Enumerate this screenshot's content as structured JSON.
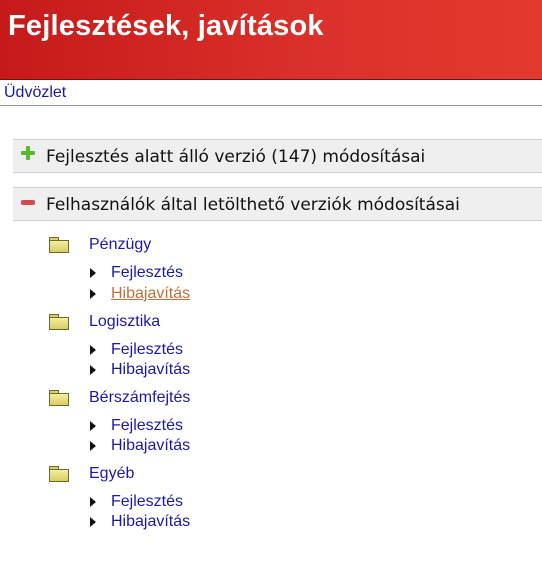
{
  "header": {
    "title": "Fejlesztések, javítások"
  },
  "breadcrumb": {
    "label": "Üdvözlet"
  },
  "sections": [
    {
      "label": "Fejlesztés alatt álló verzió (147) módosításai",
      "state": "collapsed",
      "icon": "plus-icon"
    },
    {
      "label": "Felhasználók által letölthető verziók módosításai",
      "state": "expanded",
      "icon": "minus-icon"
    }
  ],
  "categories": [
    {
      "label": "Pénzügy",
      "icon": "folder-icon",
      "links": [
        {
          "label": "Fejlesztés"
        },
        {
          "label": "Hibajavítás",
          "visited": true
        }
      ]
    },
    {
      "label": "Logisztika",
      "icon": "folder-icon",
      "links": [
        {
          "label": "Fejlesztés"
        },
        {
          "label": "Hibajavítás"
        }
      ]
    },
    {
      "label": "Bérszámfejtés",
      "icon": "folder-icon",
      "links": [
        {
          "label": "Fejlesztés"
        },
        {
          "label": "Hibajavítás"
        }
      ]
    },
    {
      "label": "Egyéb",
      "icon": "folder-icon",
      "links": [
        {
          "label": "Fejlesztés"
        },
        {
          "label": "Hibajavítás"
        }
      ]
    }
  ],
  "colors": {
    "header_bg": "#d9302a",
    "link": "#1a1aa6",
    "visited_link": "#c0703a",
    "section_bg": "#efefef"
  }
}
